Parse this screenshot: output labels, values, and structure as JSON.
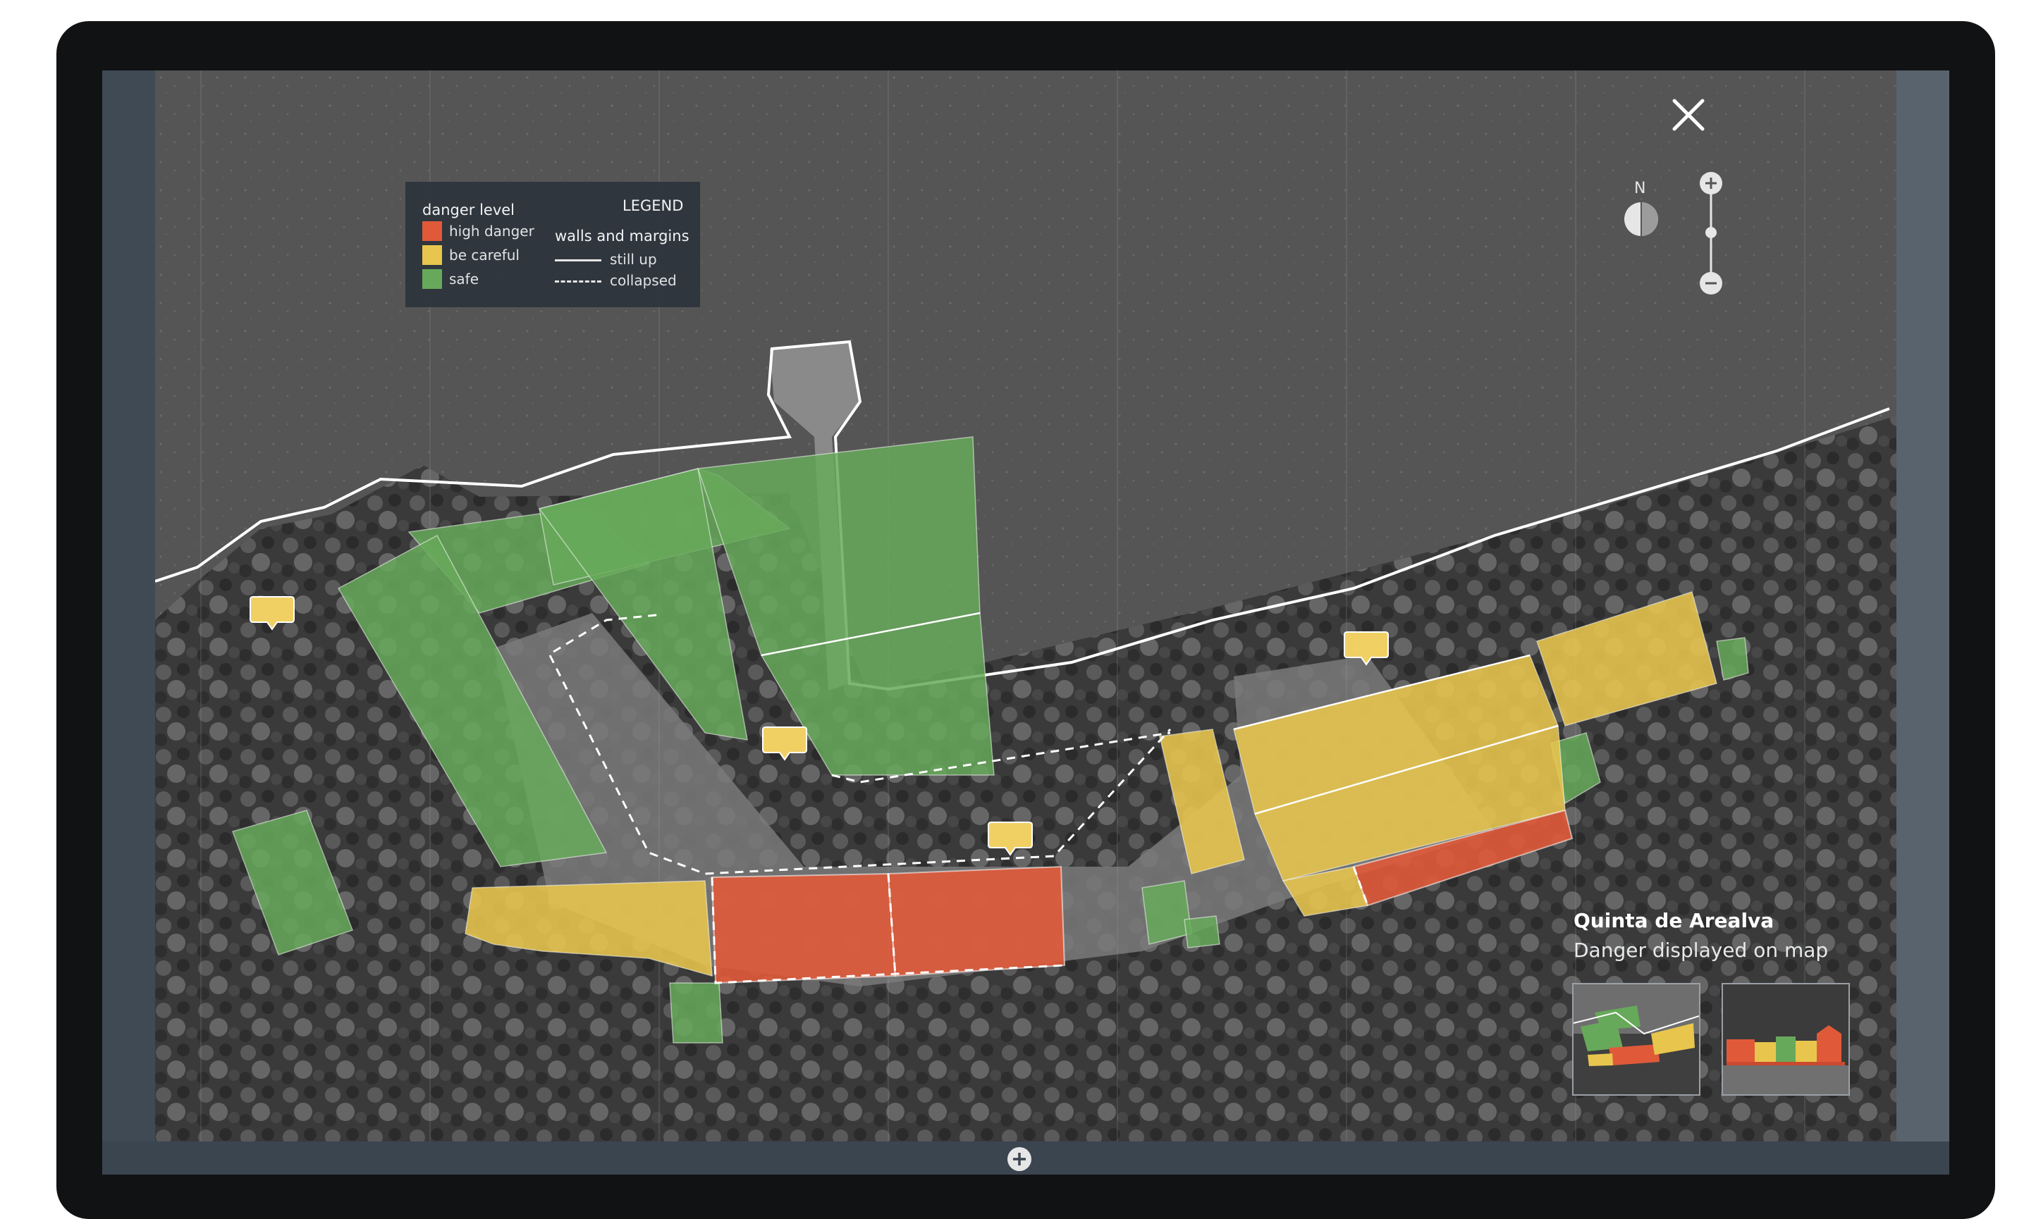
{
  "legend": {
    "title": "LEGEND",
    "danger_heading": "danger level",
    "walls_heading": "walls and margins",
    "danger_levels": [
      {
        "label": "high danger",
        "color": "#e05a3a"
      },
      {
        "label": "be careful",
        "color": "#e8c64d"
      },
      {
        "label": "safe",
        "color": "#67a95a"
      }
    ],
    "walls": [
      {
        "label": "still up",
        "style": "solid"
      },
      {
        "label": "collapsed",
        "style": "dashed"
      }
    ]
  },
  "controls": {
    "close_icon": "close-icon",
    "compass_label": "N",
    "zoom_in_icon": "plus-icon",
    "zoom_out_icon": "minus-icon",
    "expand_icon": "plus-circle-icon"
  },
  "info": {
    "title": "Quinta de Arealva",
    "subtitle": "Danger displayed on map",
    "thumbnails": [
      {
        "name": "map-view-thumbnail"
      },
      {
        "name": "elevation-view-thumbnail"
      }
    ]
  },
  "colors": {
    "high_danger": "#e05a3a",
    "be_careful": "#e8c64d",
    "safe": "#67a95a",
    "panel": "#2d343c"
  }
}
